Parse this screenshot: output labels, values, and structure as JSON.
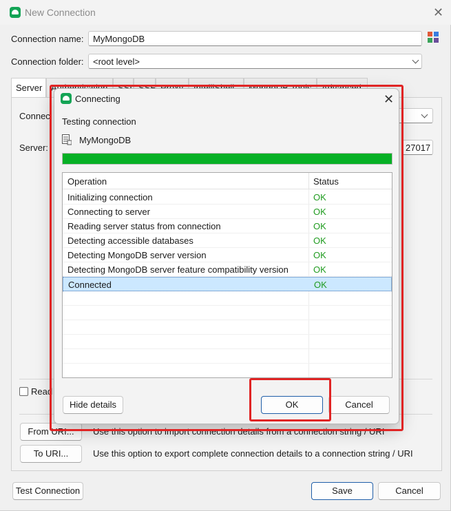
{
  "window": {
    "title": "New Connection"
  },
  "form": {
    "connection_name_label": "Connection name:",
    "connection_name_value": "MyMongoDB",
    "connection_folder_label": "Connection folder:",
    "connection_folder_value": "<root level>"
  },
  "tabs": [
    {
      "label": "Server"
    },
    {
      "label": "Authentication"
    },
    {
      "label": "SSL"
    },
    {
      "label": "SSH"
    },
    {
      "label": "Proxy"
    },
    {
      "label": "IntelliShell"
    },
    {
      "label": "MongoDB Tools"
    },
    {
      "label": "Advanced"
    }
  ],
  "server_tab": {
    "connection_label_partial": "Connec",
    "server_label": "Server:",
    "port_value": "27017",
    "read_only_partial": "Read"
  },
  "uri": {
    "from_uri_button": "From URI...",
    "from_uri_desc": "Use this option to import connection details from a connection string / URI",
    "to_uri_button": "To URI...",
    "to_uri_desc": "Use this option to export complete connection details to a connection string / URI"
  },
  "footer": {
    "test_connection": "Test Connection",
    "save": "Save",
    "cancel": "Cancel"
  },
  "dialog": {
    "title": "Connecting",
    "testing_label": "Testing connection",
    "connection_name": "MyMongoDB",
    "progress_percent": 100,
    "columns": {
      "operation": "Operation",
      "status": "Status"
    },
    "rows": [
      {
        "operation": "Initializing connection",
        "status": "OK"
      },
      {
        "operation": "Connecting to server",
        "status": "OK"
      },
      {
        "operation": "Reading server status from connection",
        "status": "OK"
      },
      {
        "operation": "Detecting accessible databases",
        "status": "OK"
      },
      {
        "operation": "Detecting MongoDB server version",
        "status": "OK"
      },
      {
        "operation": "Detecting MongoDB server feature compatibility version",
        "status": "OK"
      },
      {
        "operation": "Connected",
        "status": "OK"
      }
    ],
    "hide_details": "Hide details",
    "ok": "OK",
    "cancel": "Cancel"
  },
  "colors": {
    "brand_green": "#13a455",
    "progress_green": "#06b025",
    "status_ok": "#1f9b1f",
    "selection": "#cce8ff",
    "highlight_red": "#e02424",
    "primary_border": "#1f5ea8"
  }
}
